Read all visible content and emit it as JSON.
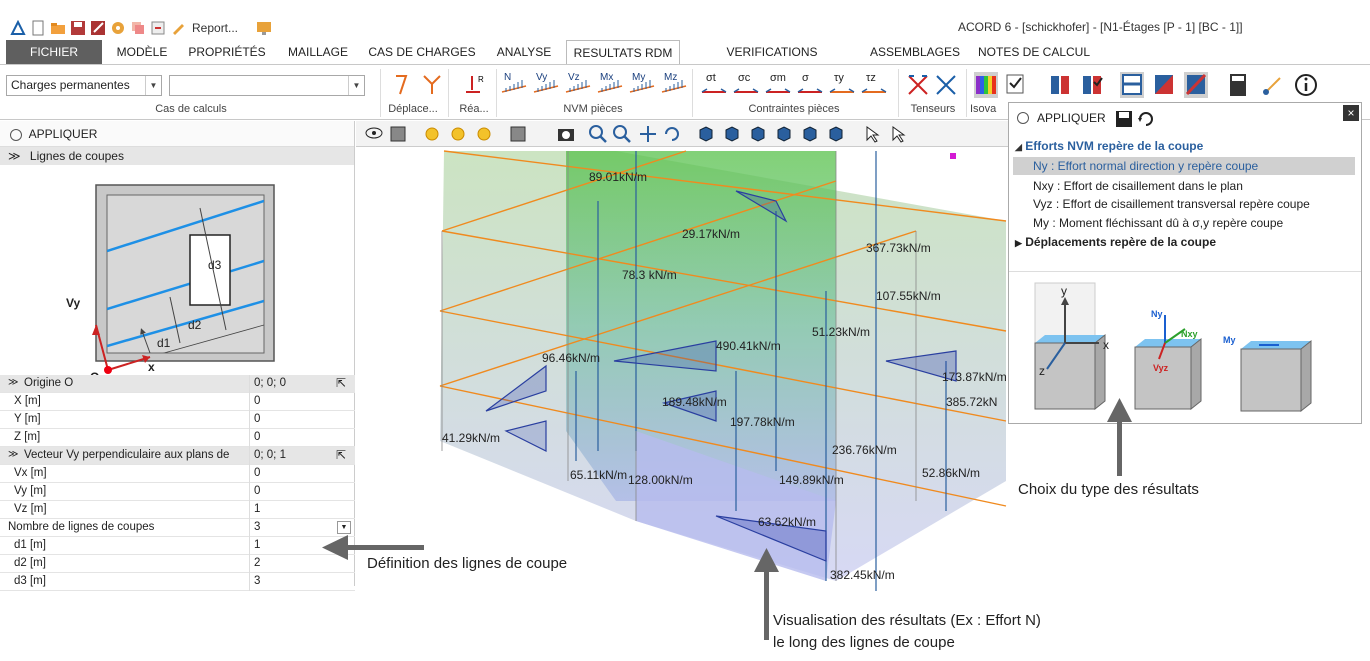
{
  "window": {
    "title": "ACORD 6 - [schickhofer] - [N1-Étages [P - 1] [BC - 1]]",
    "report_label": "Report..."
  },
  "tabs": [
    "FICHIER",
    "MODÈLE",
    "PROPRIÉTÉS",
    "MAILLAGE",
    "CAS DE CHARGES",
    "ANALYSE",
    "RESULTATS RDM",
    "VERIFICATIONS EUROCODES",
    "ASSEMBLAGES",
    "NOTES DE CALCUL"
  ],
  "active_tab": "RESULTATS RDM",
  "ribbon": {
    "load_case": "Charges permanentes",
    "load_case_secondary": "",
    "groups": {
      "cas": "Cas de calculs",
      "deplace": "Déplace...",
      "rea": "Réa...",
      "nvm": "NVM pièces",
      "contraintes": "Contraintes pièces",
      "tenseurs": "Tenseurs",
      "isova": "Isova"
    },
    "icons": {
      "rea": "R",
      "nvm": [
        "N",
        "Vy",
        "Vz",
        "Mx",
        "My",
        "Mz"
      ],
      "contraintes": [
        "σt",
        "σc",
        "σm",
        "σ",
        "τy",
        "τz"
      ]
    }
  },
  "left_panel": {
    "apply": "APPLIQUER",
    "section": "Lignes de coupes",
    "diagram_labels": {
      "vy": "Vy",
      "origin": "O",
      "x": "x",
      "d1": "d1",
      "d2": "d2",
      "d3": "d3"
    },
    "rows": [
      {
        "k": "Origine O",
        "v": "0; 0; 0",
        "group": true
      },
      {
        "k": "X  [m]",
        "v": "0"
      },
      {
        "k": "Y  [m]",
        "v": "0"
      },
      {
        "k": "Z  [m]",
        "v": "0"
      },
      {
        "k": "Vecteur Vy perpendiculaire aux plans de",
        "v": "0; 0; 1",
        "group": true
      },
      {
        "k": "Vx  [m]",
        "v": "0"
      },
      {
        "k": "Vy  [m]",
        "v": "0"
      },
      {
        "k": "Vz  [m]",
        "v": "1"
      },
      {
        "k": "Nombre de lignes de coupes",
        "v": "3"
      },
      {
        "k": "d1  [m]",
        "v": "1"
      },
      {
        "k": "d2  [m]",
        "v": "2"
      },
      {
        "k": "d3  [m]",
        "v": "3"
      }
    ]
  },
  "viewport": {
    "labels": [
      "89.01kN/m",
      "29.17kN/m",
      "367.73kN/m",
      "78.3 kN/m",
      "107.55kN/m",
      "51.23kN/m",
      "490.41kN/m",
      "96.46kN/m",
      "173.87kN/m",
      "385.72kN",
      "189.48kN/m",
      "197.78kN/m",
      "41.29kN/m",
      "236.76kN/m",
      "149.89kN/m",
      "52.86kN/m",
      "65.11kN/m",
      "128.00kN/m",
      "63.62kN/m",
      "382.45kN/m"
    ]
  },
  "right_panel": {
    "apply": "APPLIQUER",
    "efforts": "Efforts NVM repère de la coupe",
    "items": [
      "Ny : Effort normal direction y repère coupe",
      "Nxy : Effort de cisaillement dans le plan",
      "Vyz : Effort de cisaillement transversal repère coupe",
      "My : Moment fléchissant dû à σ,y repère coupe"
    ],
    "deplacements": "Déplacements repère de la coupe",
    "diagram_labels": {
      "y": "y",
      "x": "x",
      "z": "z",
      "ny": "Ny",
      "nxy": "Nxy",
      "vyz": "Vyz",
      "my": "My"
    }
  },
  "annotations": {
    "choix": "Choix du type des résultats",
    "definition": "Définition des lignes de coupe",
    "visu1": "Visualisation des résultats (Ex : Effort N)",
    "visu2": "le long des lignes de coupe"
  },
  "colors": {
    "accent": "#2a5f9e",
    "file_tab": "#5f5f5f",
    "orange": "#f08a1e"
  }
}
